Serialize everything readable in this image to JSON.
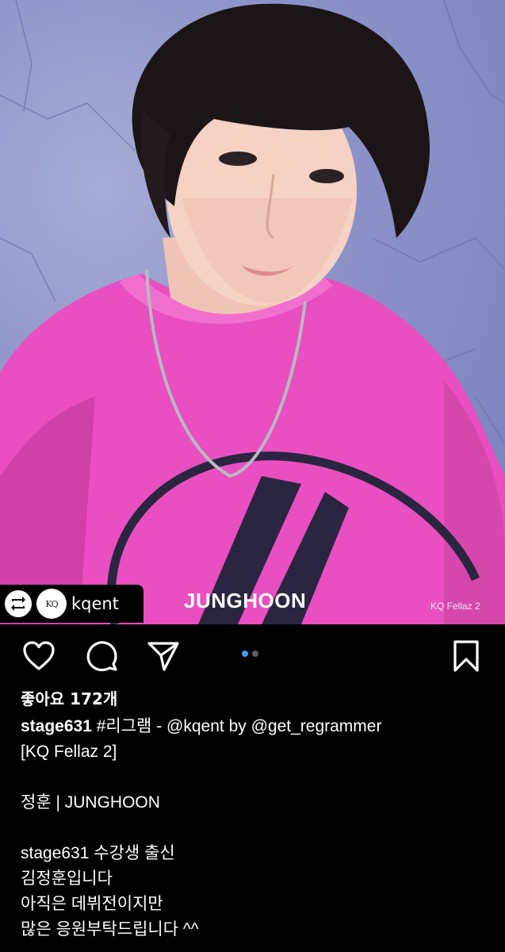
{
  "post": {
    "repost_username": "kqent",
    "brand_logo_text": "KQ",
    "photo_name": "JUNGHOON",
    "photo_credit": "KQ Fellaz 2"
  },
  "actions": {
    "icons": [
      "heart-icon",
      "comment-icon",
      "share-icon",
      "bookmark-icon"
    ],
    "carousel": {
      "total": 2,
      "active": 1
    }
  },
  "caption": {
    "likes": "좋아요 172개",
    "username": "stage631",
    "first_line_rest": " #리그램 - @kqent by @get_regrammer",
    "line2": "[KQ Fellaz 2]",
    "line3": "정훈 | JUNGHOON",
    "line4": "stage631 수강생 출신",
    "line5": "김정훈입니다",
    "line6": "아직은 데뷔전이지만",
    "line7": "많은 응원부탁드립니다 ^^"
  },
  "colors": {
    "background": "#000000",
    "carousel_active": "#3d9cf5",
    "carousel_inactive": "#5e5e5e"
  }
}
